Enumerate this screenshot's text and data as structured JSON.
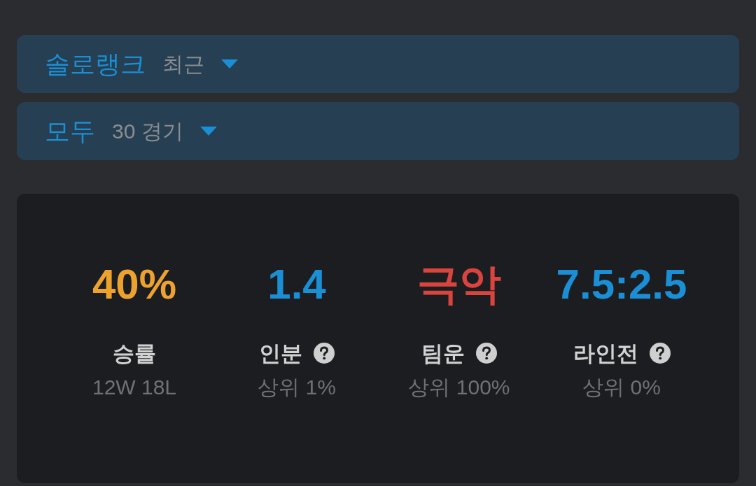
{
  "filters": [
    {
      "label": "솔로랭크",
      "value": "최근"
    },
    {
      "label": "모두",
      "value": "30 경기"
    }
  ],
  "stats": [
    {
      "value": "40%",
      "color": "#eea22e",
      "label": "승률",
      "help": false,
      "detail": "12W 18L"
    },
    {
      "value": "1.4",
      "color": "#1a8fd6",
      "label": "인분",
      "help": true,
      "detail": "상위 1%"
    },
    {
      "value": "극악",
      "color": "#d9443f",
      "label": "팀운",
      "help": true,
      "detail": "상위 100%"
    },
    {
      "value": "7.5:2.5",
      "color": "#1a8fd6",
      "label": "라인전",
      "help": true,
      "detail": "상위 0%"
    }
  ]
}
